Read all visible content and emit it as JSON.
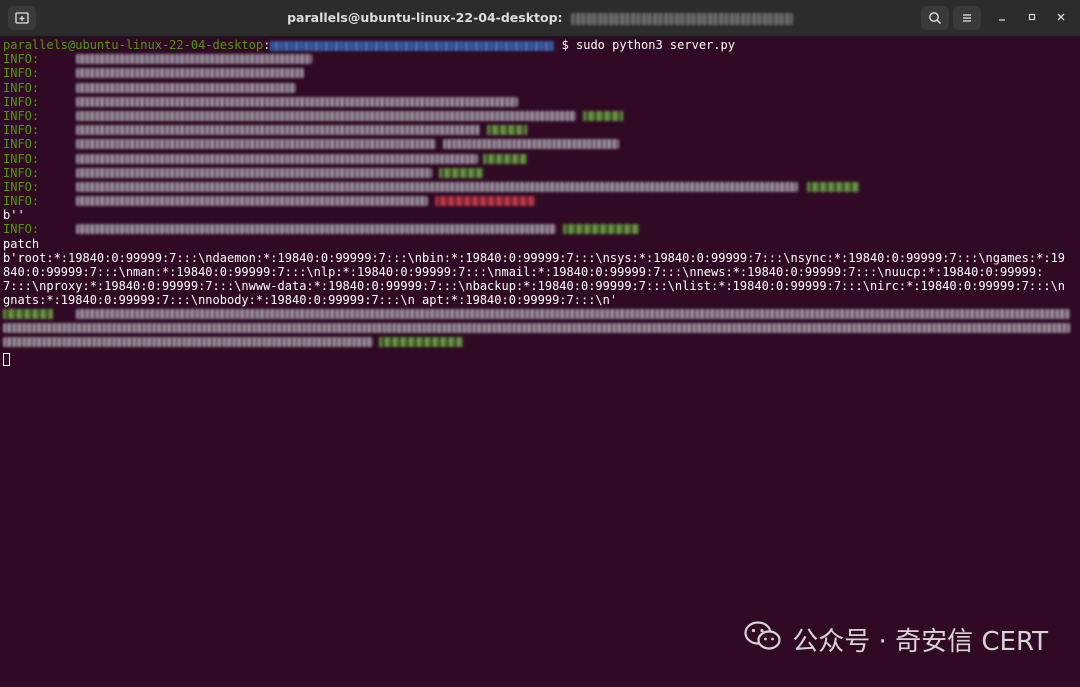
{
  "window": {
    "title": "parallels@ubuntu-linux-22-04-desktop: ",
    "new_tab_icon": "new-tab-icon",
    "search_icon": "search-icon",
    "menu_icon": "hamburger-menu-icon",
    "minimize_icon": "minimize-icon",
    "maximize_icon": "maximize-icon",
    "close_icon": "close-icon"
  },
  "terminal": {
    "prompt_user": "parallels@ubuntu-linux-22-04-desktop",
    "prompt_colon": ":",
    "prompt_command": "$ sudo python3 server.py",
    "info_label": "INFO:",
    "bytes_empty": "b''",
    "patch_label": "patch",
    "output_dump": "b'root:*:19840:0:99999:7:::\\ndaemon:*:19840:0:99999:7:::\\nbin:*:19840:0:99999:7:::\\nsys:*:19840:0:99999:7:::\\nsync:*:19840:0:99999:7:::\\ngames:*:19840:0:99999:7:::\\nman:*:19840:0:99999:7:::\\nlp:*:19840:0:99999:7:::\\nmail:*:19840:0:99999:7:::\\nnews:*:19840:0:99999:7:::\\nuucp:*:19840:0:99999:7:::\\nproxy:*:19840:0:99999:7:::\\nwww-data:*:19840:0:99999:7:::\\nbackup:*:19840:0:99999:7:::\\nlist:*:19840:0:99999:7:::\\nirc:*:19840:0:99999:7:::\\ngnats:*:19840:0:99999:7:::\\nnobody:*:19840:0:99999:7:::\\n apt:*:19840:0:99999:7:::\\n'"
  },
  "watermark": {
    "text": "公众号 · 奇安信 CERT",
    "icon": "wechat-icon"
  },
  "colors": {
    "terminal_bg": "#300a24",
    "prompt_green": "#4e9a06",
    "path_blue": "#3465a4",
    "titlebar_bg": "#2c2c2c"
  }
}
